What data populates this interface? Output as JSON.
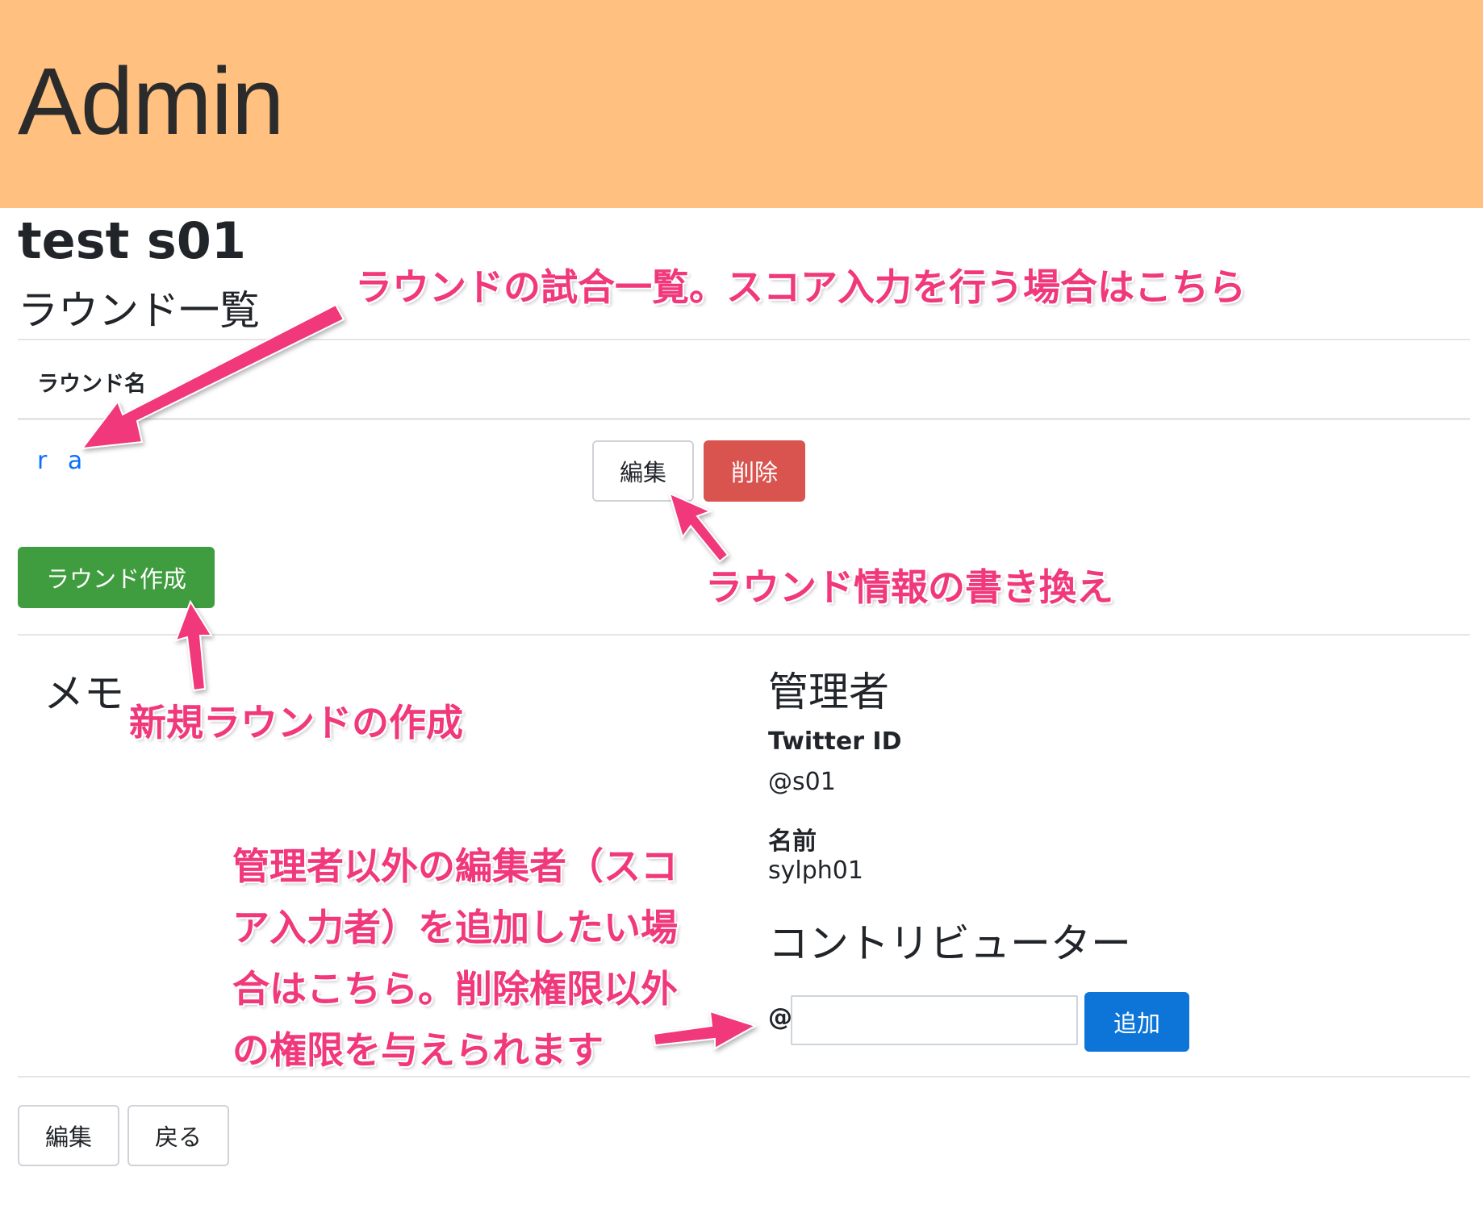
{
  "header": {
    "title": "Admin",
    "bg_color": "#ffc080"
  },
  "event": {
    "title": "test s01"
  },
  "rounds": {
    "section_title": "ラウンド一覧",
    "column_header": "ラウンド名",
    "items": [
      {
        "name": "r a",
        "edit_label": "編集",
        "delete_label": "削除"
      }
    ],
    "create_label": "ラウンド作成"
  },
  "memo": {
    "title": "メモ"
  },
  "admin": {
    "title": "管理者",
    "twitter_label": "Twitter ID",
    "twitter_value": "@s01",
    "name_label": "名前",
    "name_value": "sylph01"
  },
  "contributors": {
    "title": "コントリビューター",
    "prefix": "@",
    "input_value": "",
    "add_label": "追加"
  },
  "footer": {
    "edit_label": "編集",
    "back_label": "戻る"
  },
  "annotations": {
    "rounds_list": "ラウンドの試合一覧。スコア入力を行う場合はこちら",
    "edit_round": "ラウンド情報の書き換え",
    "create_round": "新規ラウンドの作成",
    "contributor_lines": [
      "管理者以外の編集者（スコ",
      "ア入力者）を追加したい場",
      "合はこちら。削除権限以外",
      "の権限を与えられます"
    ],
    "color": "#f0387a"
  },
  "colors": {
    "danger": "#d9534f",
    "success": "#3f9d3f",
    "primary": "#0d75d8",
    "link": "#0d6efd"
  }
}
